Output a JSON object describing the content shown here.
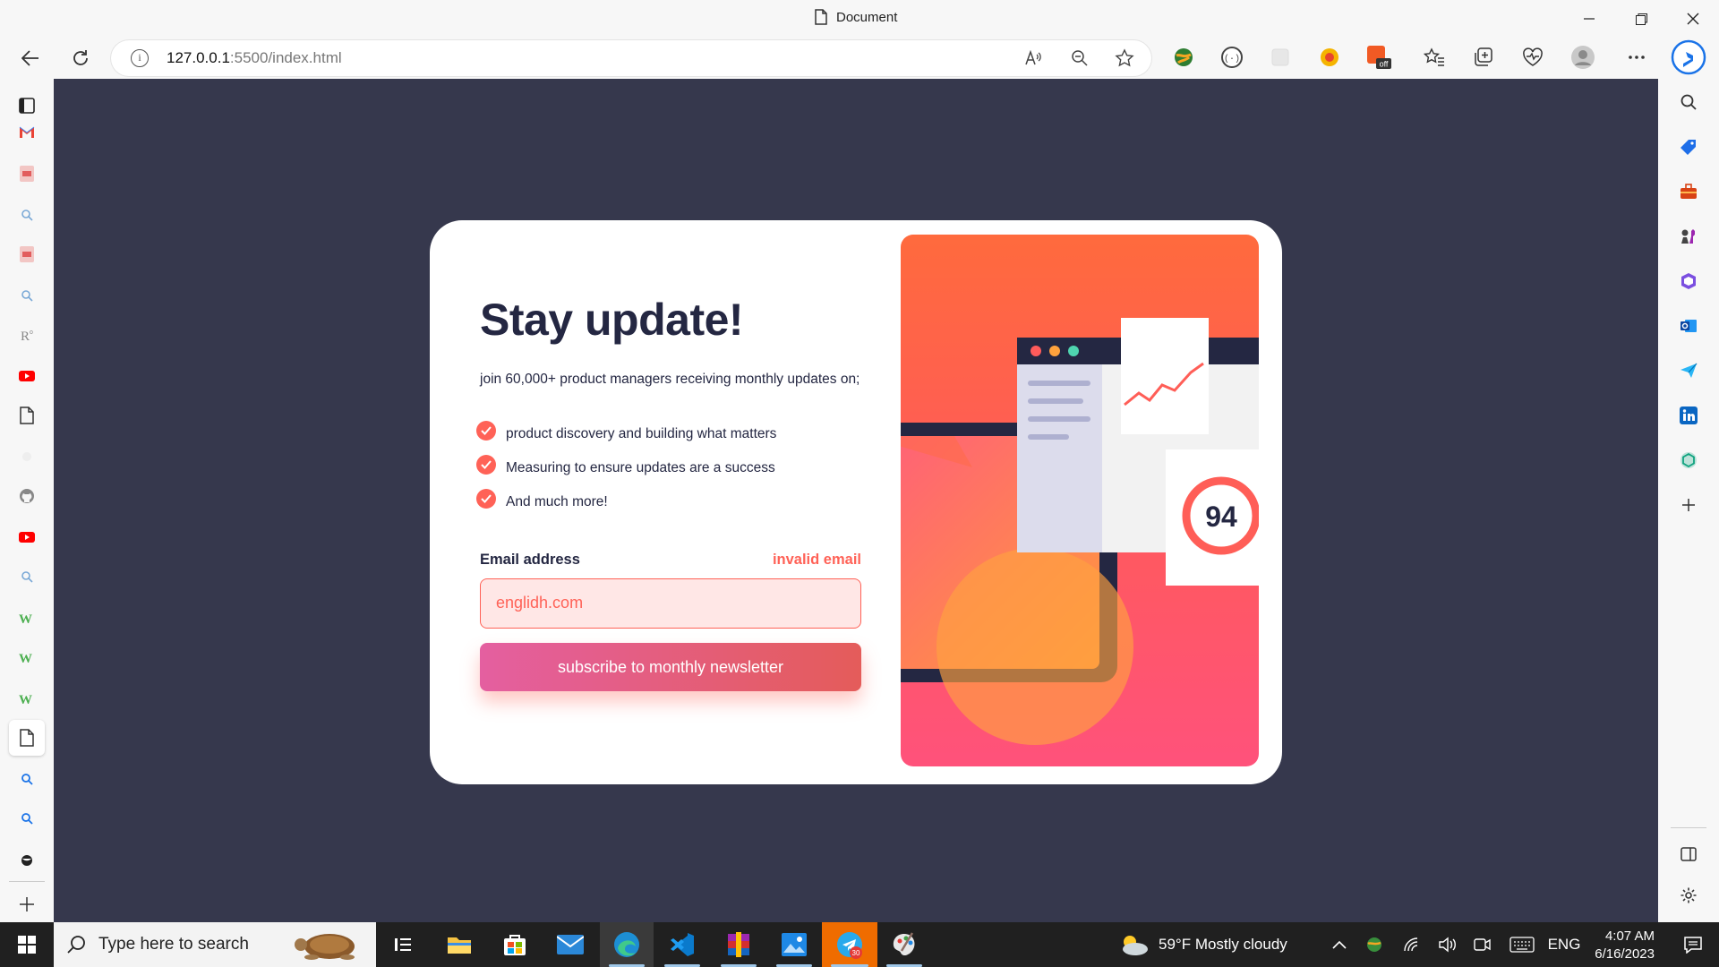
{
  "window": {
    "title": "Document"
  },
  "address_bar": {
    "host": "127.0.0.1",
    "path": ":5500/index.html"
  },
  "page": {
    "heading": "Stay update!",
    "intro": "join 60,000+ product managers receiving monthly updates on;",
    "bullets": [
      "product discovery and building what matters",
      "Measuring to ensure updates are a success",
      "And much more!"
    ],
    "email_label": "Email address",
    "email_error": "invalid email",
    "email_value": "englidh.com",
    "subscribe_label": "subscribe to monthly newsletter",
    "score": "94"
  },
  "extensions": {
    "badge": "off"
  },
  "taskbar": {
    "search_placeholder": "Type here to search",
    "weather": "59°F  Mostly cloudy",
    "language": "ENG",
    "time": "4:07 AM",
    "date": "6/16/2023",
    "telegram_badge": "30"
  },
  "colors": {
    "accent": "#ff6257",
    "dark": "#242742",
    "background": "#36384d"
  }
}
